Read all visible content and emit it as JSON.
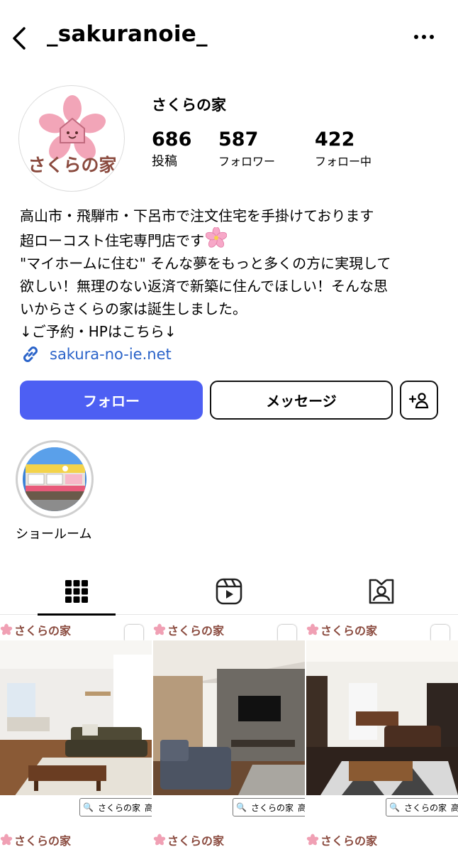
{
  "header": {
    "username": "_sakuranoie_",
    "back_icon": "chevron-left-icon",
    "more_icon": "more-horizontal-icon"
  },
  "profile": {
    "display_name": "さくらの家",
    "avatar_text": "さくらの家",
    "stats": {
      "posts": {
        "value": "686",
        "label": "投稿"
      },
      "followers": {
        "value": "587",
        "label": "フォロワー"
      },
      "following": {
        "value": "422",
        "label": "フォロー中"
      }
    },
    "bio": {
      "line1": "高山市・飛騨市・下呂市で注文住宅を手掛けております",
      "line2": "超ローコスト住宅専門店です",
      "line3": "\"マイホームに住む\" そんな夢をもっと多くの方に実現して",
      "line4": "欲しい！無理のない返済で新築に住んでほしい！そんな思",
      "line5": "いからさくらの家は誕生しました。",
      "line6": "↓ご予約・HPはこちら↓"
    },
    "link": "sakura-no-ie.net"
  },
  "actions": {
    "follow_label": "フォロー",
    "message_label": "メッセージ",
    "suggest_icon": "add-person-icon"
  },
  "highlights": [
    {
      "label": "ショールーム"
    }
  ],
  "tabs": [
    {
      "icon": "grid-icon",
      "active": true
    },
    {
      "icon": "reels-icon",
      "active": false
    },
    {
      "icon": "tagged-icon",
      "active": false
    }
  ],
  "posts": {
    "brand": "さくらの家",
    "search_text": "さくらの家",
    "search_suffix": "高山"
  },
  "colors": {
    "follow_button": "#4d5ff3",
    "link": "#2a63c9",
    "brand_pink": "#f0a0b4",
    "brand_brown": "#8a4a3e"
  }
}
